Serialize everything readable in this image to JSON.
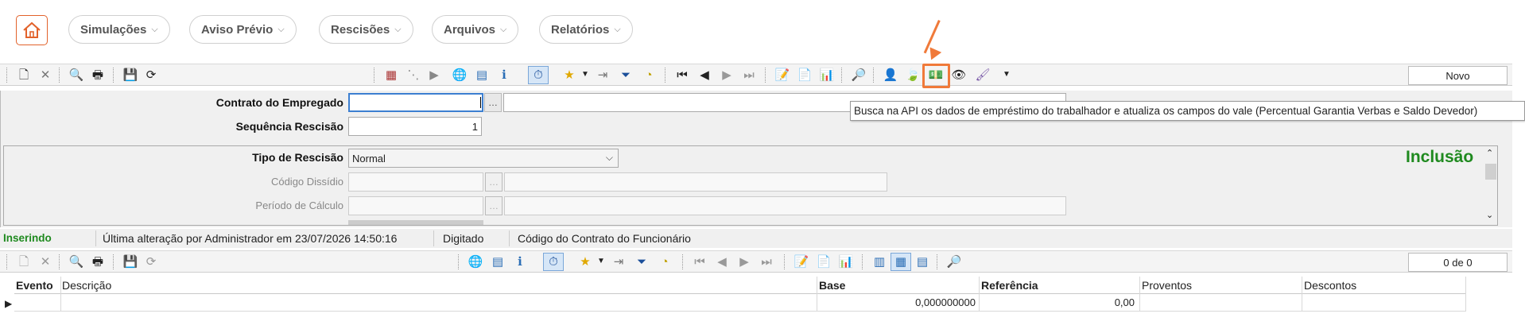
{
  "nav": {
    "items": [
      {
        "label": "Simulações"
      },
      {
        "label": "Aviso Prévio"
      },
      {
        "label": "Rescisões"
      },
      {
        "label": "Arquivos"
      },
      {
        "label": "Relatórios"
      }
    ]
  },
  "toolbar_top": {
    "right_label": "Novo",
    "tooltip": "Busca na API os dados de empréstimo do trabalhador e atualiza os campos do vale (Percentual Garantia Verbas e Saldo Devedor)"
  },
  "form": {
    "contrato_label": "Contrato do Empregado",
    "contrato_value": "",
    "sequencia_label": "Sequência Rescisão",
    "sequencia_value": "1",
    "tipo_label": "Tipo de Rescisão",
    "tipo_value": "Normal",
    "codigo_dissidio_label": "Código Dissídio",
    "periodo_label": "Período de Cálculo",
    "mode_label": "Inclusão"
  },
  "status": {
    "state": "Inserindo",
    "last_change": "Última alteração por Administrador em 23/07/2026 14:50:16",
    "input_mode": "Digitado",
    "hint": "Código do Contrato do Funcionário"
  },
  "toolbar_bottom": {
    "counter": "0 de 0"
  },
  "grid": {
    "columns": [
      "Evento",
      "Descrição",
      "Base",
      "Referência",
      "Proventos",
      "Descontos"
    ],
    "rows": [
      {
        "evento": "",
        "descricao": "",
        "base": "0,000000000",
        "referencia": "0,00",
        "proventos": "",
        "descontos": ""
      }
    ]
  },
  "colors": {
    "accent": "#e2622b",
    "mode_green": "#1f8a1f",
    "status_green": "#1f8a1f",
    "highlight": "#f07a3a"
  }
}
